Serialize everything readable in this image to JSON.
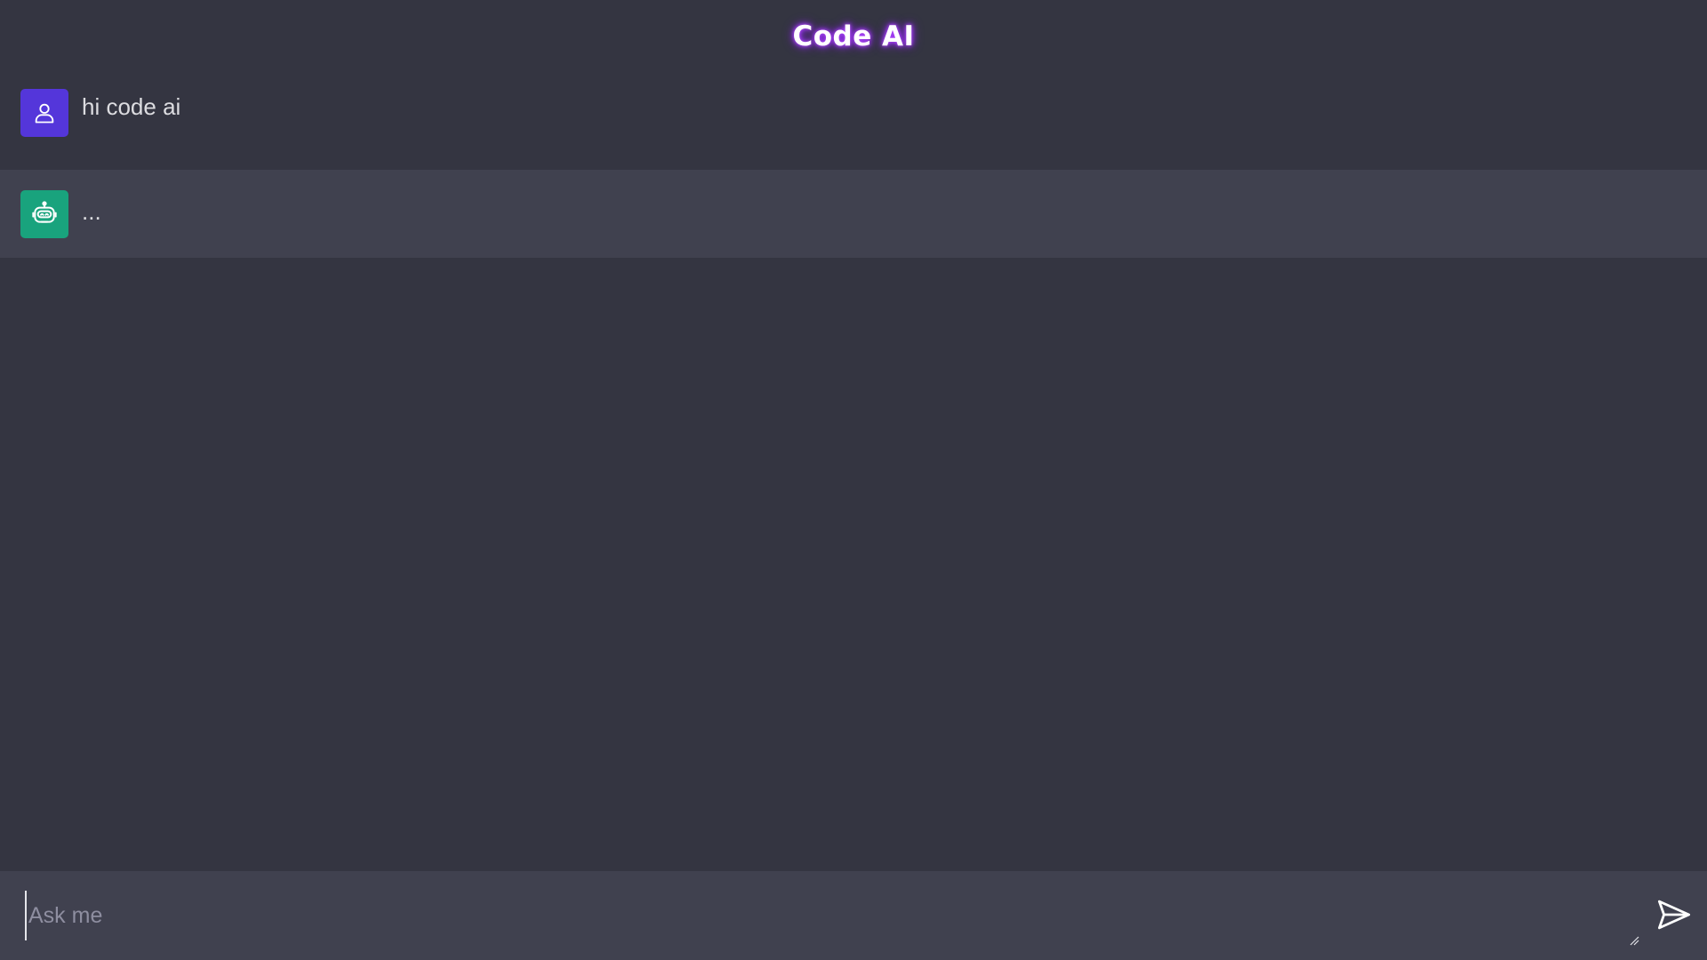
{
  "header": {
    "title": "Code AI"
  },
  "chat": {
    "messages": [
      {
        "role": "user",
        "avatar_icon": "user-icon",
        "text": "hi code ai"
      },
      {
        "role": "bot",
        "avatar_icon": "robot-icon",
        "text": "..."
      }
    ]
  },
  "composer": {
    "placeholder": "Ask me",
    "value": "",
    "send_icon": "send-icon"
  },
  "colors": {
    "background": "#343541",
    "bot_row": "#40414f",
    "user_avatar": "#5436da",
    "bot_avatar": "#19a37d",
    "title_glow": "#9b2cff"
  }
}
